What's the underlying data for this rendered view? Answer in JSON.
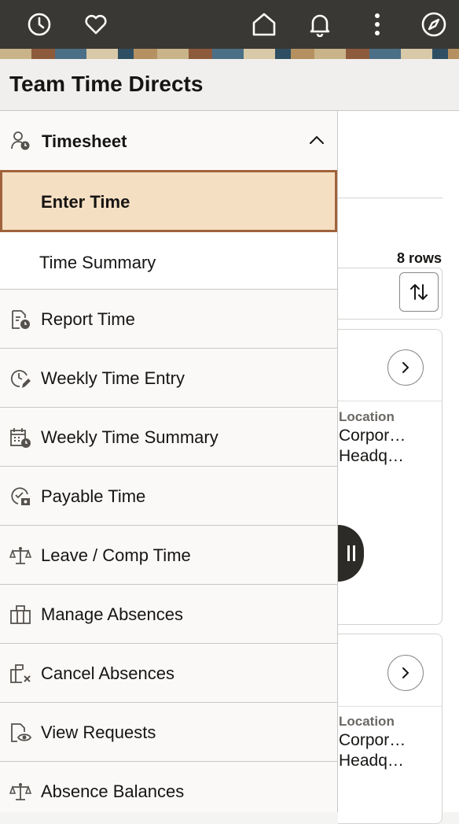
{
  "topbar": {
    "icons": [
      "recent-history-icon",
      "favorites-icon",
      "home-icon",
      "notifications-icon",
      "more-options-icon",
      "navigator-icon"
    ]
  },
  "header": {
    "title": "Team Time Directs"
  },
  "content": {
    "rows_count": "8 rows",
    "cards": [
      {
        "location_label": "Location",
        "location_line1": "Corpor…",
        "location_line2": "Headq…"
      },
      {
        "location_label": "Location",
        "location_line1": "Corpor…",
        "location_line2": "Headq…"
      }
    ]
  },
  "sidenav": {
    "group": {
      "label": "Timesheet",
      "icon": "person-clock-icon",
      "expanded": true
    },
    "sub_items": [
      {
        "label": "Enter Time",
        "selected": true
      },
      {
        "label": "Time Summary",
        "selected": false
      }
    ],
    "items": [
      {
        "label": "Report Time",
        "icon": "report-time-icon"
      },
      {
        "label": "Weekly Time Entry",
        "icon": "weekly-time-entry-icon"
      },
      {
        "label": "Weekly Time Summary",
        "icon": "calendar-clock-icon"
      },
      {
        "label": "Payable Time",
        "icon": "payable-time-icon"
      },
      {
        "label": "Leave / Comp Time",
        "icon": "scale-icon"
      },
      {
        "label": "Manage Absences",
        "icon": "manage-absences-icon"
      },
      {
        "label": "Cancel Absences",
        "icon": "cancel-absences-icon"
      },
      {
        "label": "View Requests",
        "icon": "view-requests-icon"
      },
      {
        "label": "Absence Balances",
        "icon": "absence-balances-icon"
      }
    ]
  },
  "colors": {
    "topbar": "#3a3834",
    "selected_bg": "#f5dfc3",
    "selected_border": "#a0623c"
  }
}
